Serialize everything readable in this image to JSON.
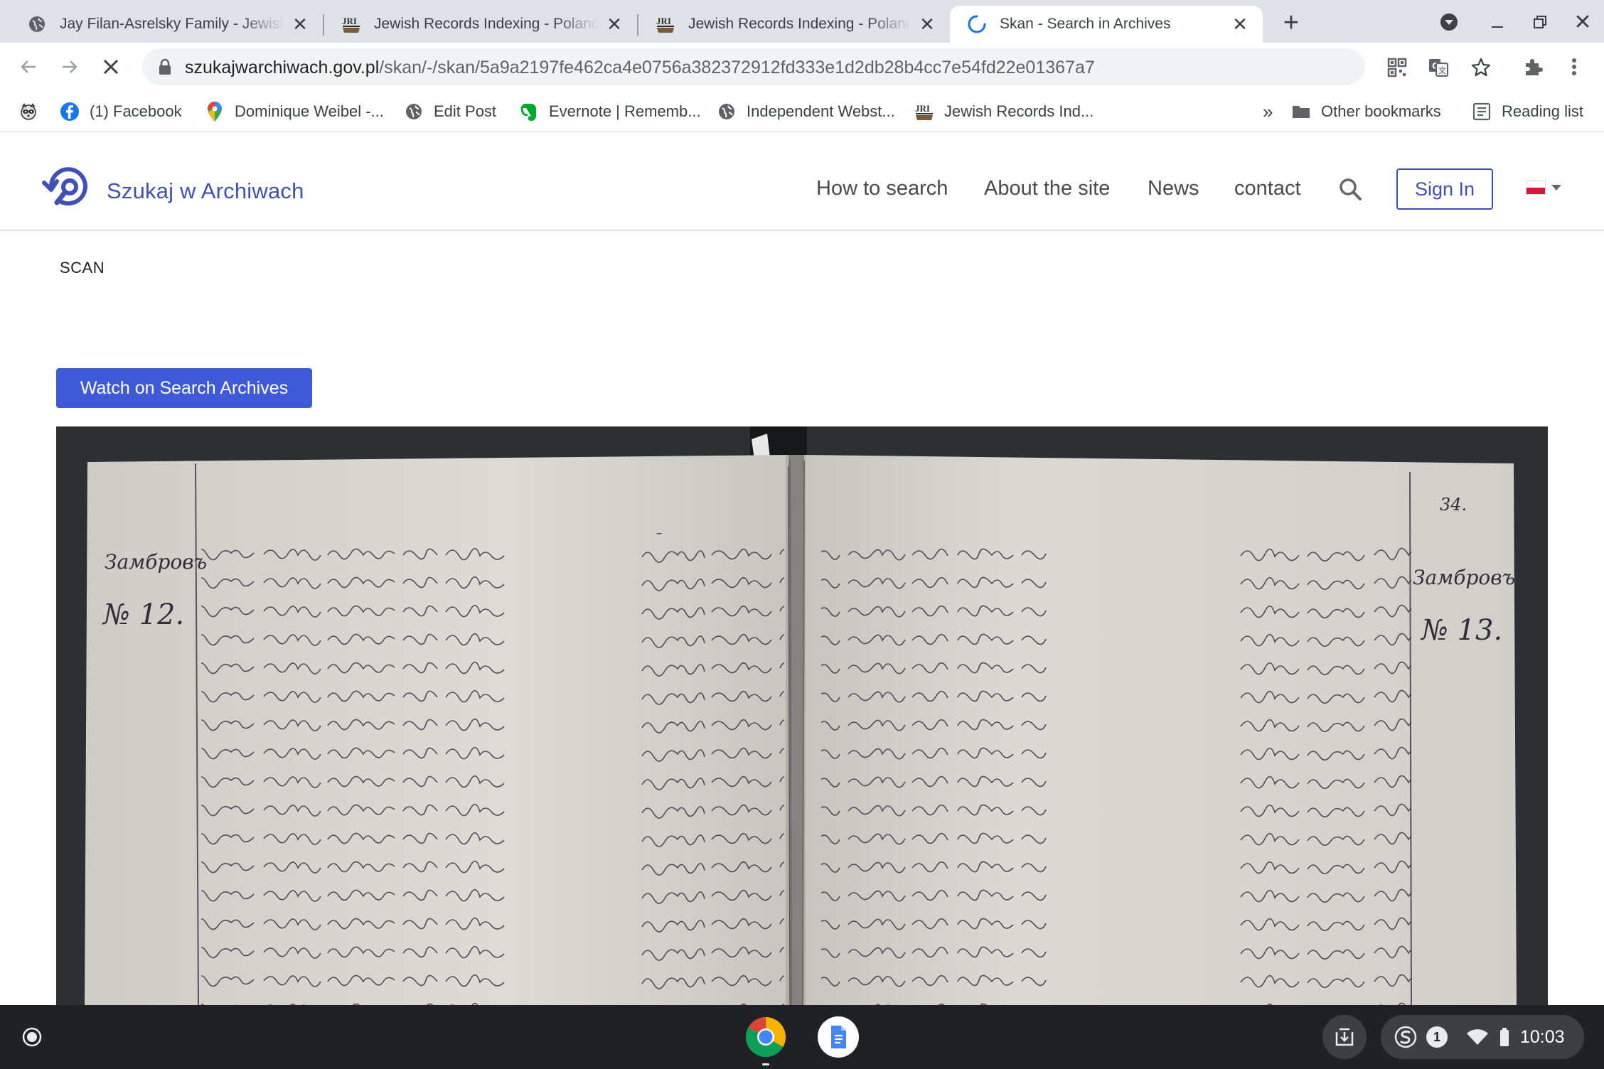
{
  "browser": {
    "tabs": [
      {
        "title": "Jay Filan-Asrelsky Family - Jewish Records",
        "icon": "globe-icon",
        "active": false
      },
      {
        "title": "Jewish Records Indexing - Poland",
        "icon": "jri-icon",
        "active": false
      },
      {
        "title": "Jewish Records Indexing - Poland",
        "icon": "jri-icon",
        "active": false
      },
      {
        "title": "Skan - Search in Archives",
        "icon": "loading-spinner-icon",
        "active": true
      }
    ],
    "url": {
      "host": "szukajwarchiwach.gov.pl",
      "path": "/skan/-/skan/5a9a2197fe462ca4e0756a382372912fd333e1d2db28b4cc7e54fd22e01367a7"
    },
    "bookmarks": [
      {
        "label": "",
        "icon": "raccoon-icon"
      },
      {
        "label": "(1) Facebook",
        "icon": "facebook-icon"
      },
      {
        "label": "Dominique Weibel -...",
        "icon": "maps-pin-icon"
      },
      {
        "label": "Edit Post",
        "icon": "globe-icon"
      },
      {
        "label": "Evernote | Rememb...",
        "icon": "evernote-icon"
      },
      {
        "label": "Independent Webst...",
        "icon": "globe-icon"
      },
      {
        "label": "Jewish Records Ind...",
        "icon": "jri-icon"
      }
    ],
    "bookmarks_overflow": "»",
    "other_bookmarks": "Other bookmarks",
    "reading_list": "Reading list"
  },
  "site": {
    "logo_text": "Szukaj w Archiwach",
    "nav": [
      "How to search",
      "About the site",
      "News",
      "contact"
    ],
    "sign_in": "Sign In",
    "language": "PL"
  },
  "page": {
    "scan_label": "SCAN",
    "watch_button": "Watch on Search Archives"
  },
  "scan": {
    "left_margin_place": "Замбровъ",
    "left_record_no": "№ 12.",
    "right_margin_place": "Замбровъ",
    "right_record_no": "№ 13.",
    "page_number": "34."
  },
  "system": {
    "clock": "10:03",
    "notification_count": "1"
  },
  "colors": {
    "brand": "#3f51b5",
    "button": "#3f5ad9",
    "paper": "#d9d6d0",
    "ink": "#2f2f3a",
    "shelf": "#202124"
  }
}
